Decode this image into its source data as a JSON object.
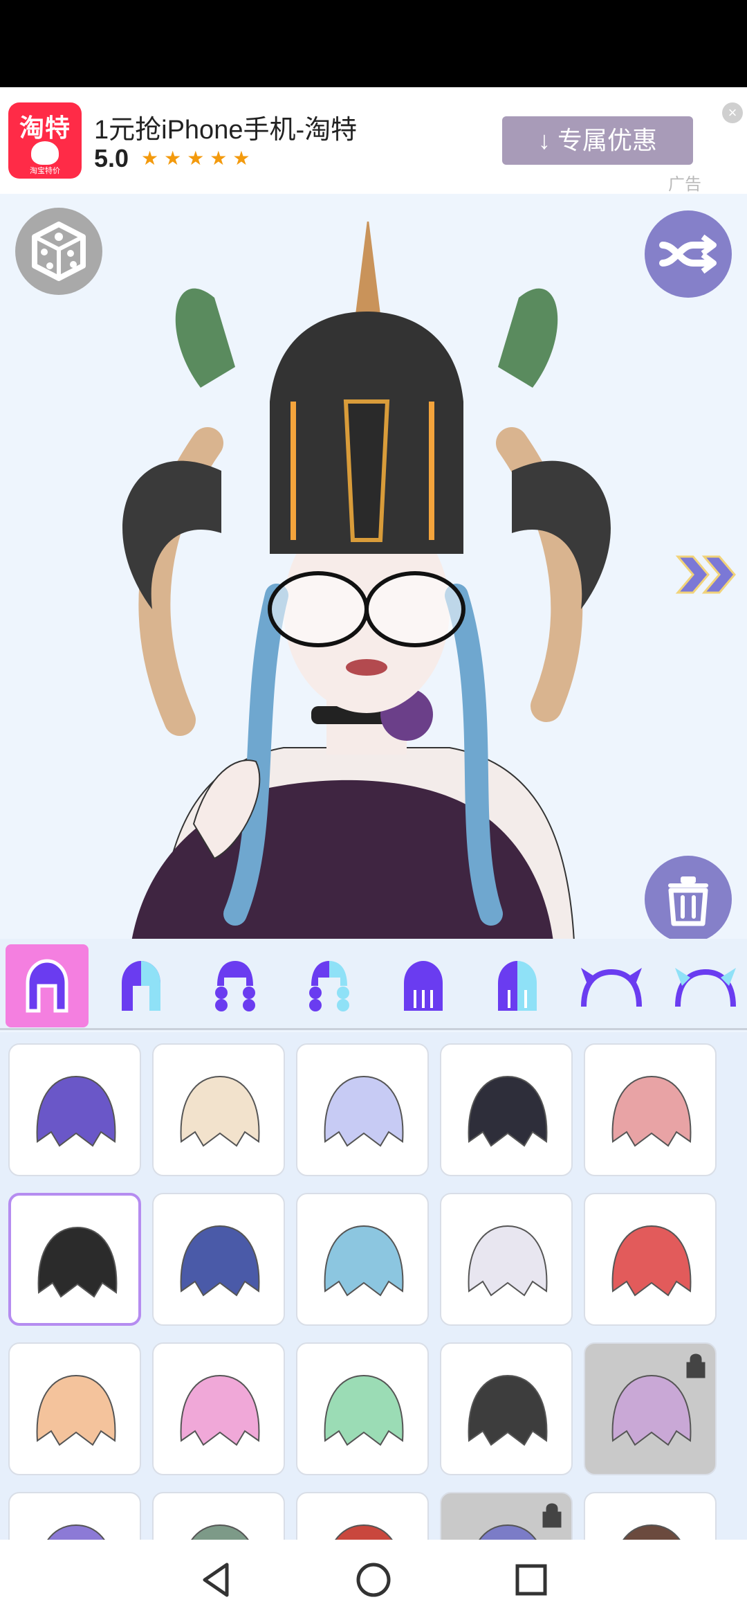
{
  "ad": {
    "logo_text": "淘特",
    "logo_subtext": "淘宝特价",
    "title": "1元抢iPhone手机-淘特",
    "rating": "5.0",
    "stars": "★★★★★",
    "cta_label": "↓ 专属优惠",
    "close_label": "×",
    "ad_tag": "广告"
  },
  "stage": {
    "buttons": [
      "dice-icon",
      "shuffle-icon",
      "next-arrows-icon",
      "trash-icon"
    ]
  },
  "tabs": {
    "selected_index": 0,
    "items": [
      "hair-front-tab",
      "hair-front-2-tab",
      "hair-braids-tab",
      "hair-braids-2-tab",
      "hair-long-tab",
      "hair-long-2-tab",
      "horns-tab",
      "horns-2-tab"
    ]
  },
  "grid": {
    "selected_index": 5,
    "locked_indices": [
      14,
      18
    ],
    "items": [
      {
        "name": "hair-purple",
        "color": "#6a57c8"
      },
      {
        "name": "hair-cream",
        "color": "#f2e2cc"
      },
      {
        "name": "hair-lavender",
        "color": "#c7cbf4"
      },
      {
        "name": "hair-black-white",
        "color": "#2e2e3a"
      },
      {
        "name": "hair-pink",
        "color": "#e8a3a5"
      },
      {
        "name": "hair-black-orange",
        "color": "#2b2b2b"
      },
      {
        "name": "hair-navy",
        "color": "#4a5aa8"
      },
      {
        "name": "hair-skyblue",
        "color": "#8cc6e0"
      },
      {
        "name": "hair-white",
        "color": "#e8e6f0"
      },
      {
        "name": "hair-red",
        "color": "#e25b5b"
      },
      {
        "name": "hair-peach",
        "color": "#f4c39c"
      },
      {
        "name": "hair-pink-ahoge",
        "color": "#f0a8d8"
      },
      {
        "name": "hair-mint",
        "color": "#9bdcb5"
      },
      {
        "name": "hair-dark-gray",
        "color": "#3d3d3d"
      },
      {
        "name": "hair-lilac-locked",
        "color": "#c9a8d6"
      },
      {
        "name": "hair-violet",
        "color": "#8c7ad6"
      },
      {
        "name": "hair-sage",
        "color": "#7d9a88"
      },
      {
        "name": "hair-crimson",
        "color": "#c9473d"
      },
      {
        "name": "hair-indigo-locked",
        "color": "#7b7cc7"
      },
      {
        "name": "hair-brown",
        "color": "#6b4a3e"
      }
    ]
  },
  "navbar": {
    "buttons": [
      "back-icon",
      "home-icon",
      "recents-icon"
    ]
  }
}
